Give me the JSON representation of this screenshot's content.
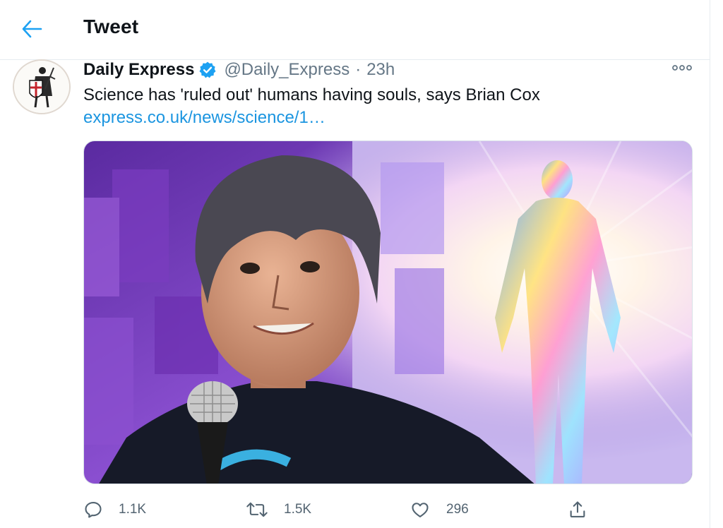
{
  "header": {
    "title": "Tweet",
    "back_icon": "arrow-left-icon"
  },
  "tweet": {
    "display_name": "Daily Express",
    "verified": true,
    "handle": "@Daily_Express",
    "separator": "·",
    "time": "23h",
    "text": "Science has 'ruled out' humans having souls, says Brian Cox",
    "link": "express.co.uk/news/science/1…"
  },
  "actions": {
    "reply_count": "1.1K",
    "retweet_count": "1.5K",
    "like_count": "296"
  },
  "colors": {
    "accent": "#1da1f2",
    "link": "#1b95e0",
    "muted": "#657786",
    "border": "#e6ecf0"
  },
  "icons": [
    "arrow-left-icon",
    "verified-badge-icon",
    "more-icon",
    "reply-icon",
    "retweet-icon",
    "like-icon",
    "share-icon"
  ]
}
